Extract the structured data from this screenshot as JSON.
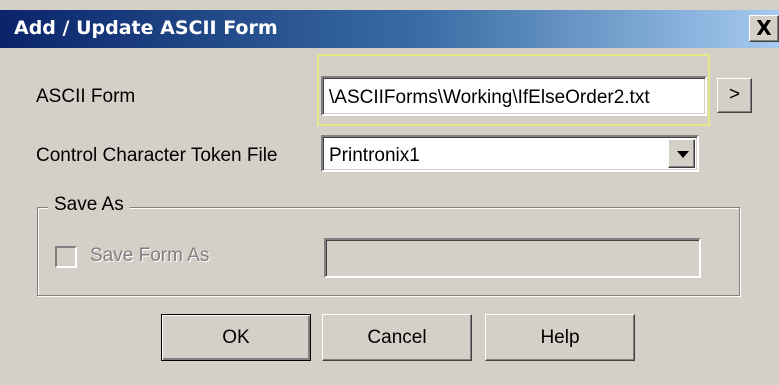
{
  "window": {
    "title": "Add / Update ASCII Form",
    "close_glyph": "X"
  },
  "ascii_form": {
    "label": "ASCII Form",
    "value": "\\ASCIIForms\\Working\\IfElseOrder2.txt",
    "browse_label": ">"
  },
  "token_file": {
    "label": "Control Character Token File",
    "selected": "Printronix1"
  },
  "save_as": {
    "group_label": "Save As",
    "checkbox_label": "Save Form As",
    "checked": false,
    "value": ""
  },
  "buttons": {
    "ok": "OK",
    "cancel": "Cancel",
    "help": "Help"
  },
  "icons": {
    "close": "close-icon",
    "dropdown": "chevron-down-icon"
  }
}
